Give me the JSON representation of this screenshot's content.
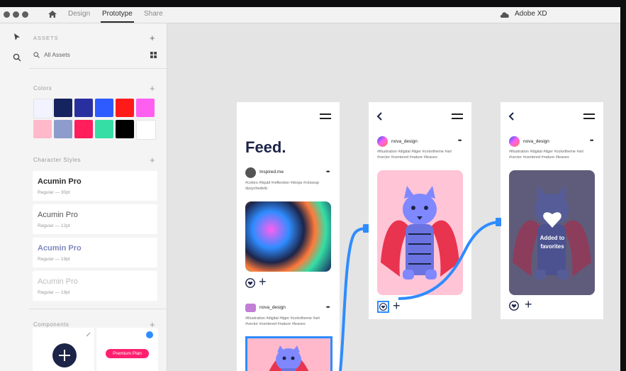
{
  "titlebar": {
    "tabs": [
      "Design",
      "Prototype",
      "Share"
    ],
    "active_tab": "Prototype",
    "app_name": "Adobe XD"
  },
  "assets": {
    "header": "ASSETS",
    "search_placeholder": "All Assets",
    "colors_label": "Colors",
    "colors": [
      "#f1f4ff",
      "#15235e",
      "#2a2fa0",
      "#2e5bff",
      "#ff1a1a",
      "#ff5ff1",
      "#ffb9cb",
      "#8e9ccb",
      "#ff1d5b",
      "#35dea5",
      "#000000",
      "#ffffff"
    ],
    "character_styles_label": "Character Styles",
    "character_styles": [
      {
        "name": "Acumin Pro",
        "detail": "Regular — 30pt"
      },
      {
        "name": "Acumin Pro",
        "detail": "Regular — 12pt"
      },
      {
        "name": "Acumin Pro",
        "detail": "Regular — 19pt"
      },
      {
        "name": "Acumin Pro",
        "detail": "Regular — 19pt"
      }
    ],
    "components_label": "Components",
    "component_button_label": "Premium Plan"
  },
  "artboard1": {
    "title": "Feed.",
    "post1_user": "Inspired.me",
    "post1_tags": "#colors #liquid #reflection #drops #closeup #psychedelic",
    "post2_user": "nova_design",
    "post2_tags": "#illustration #digital #tiger #colortheme #art #vector #centered #nature #leaves"
  },
  "artboard2": {
    "user": "nova_design",
    "tags": "#illustration #digital #tiger #colortheme #art #vector #centered #nature #leaves"
  },
  "artboard3": {
    "user": "nova_design",
    "tags": "#illustration #digital #tiger #colortheme #art #vector #centered #nature #leaves",
    "overlay_text": "Added to favorites"
  }
}
